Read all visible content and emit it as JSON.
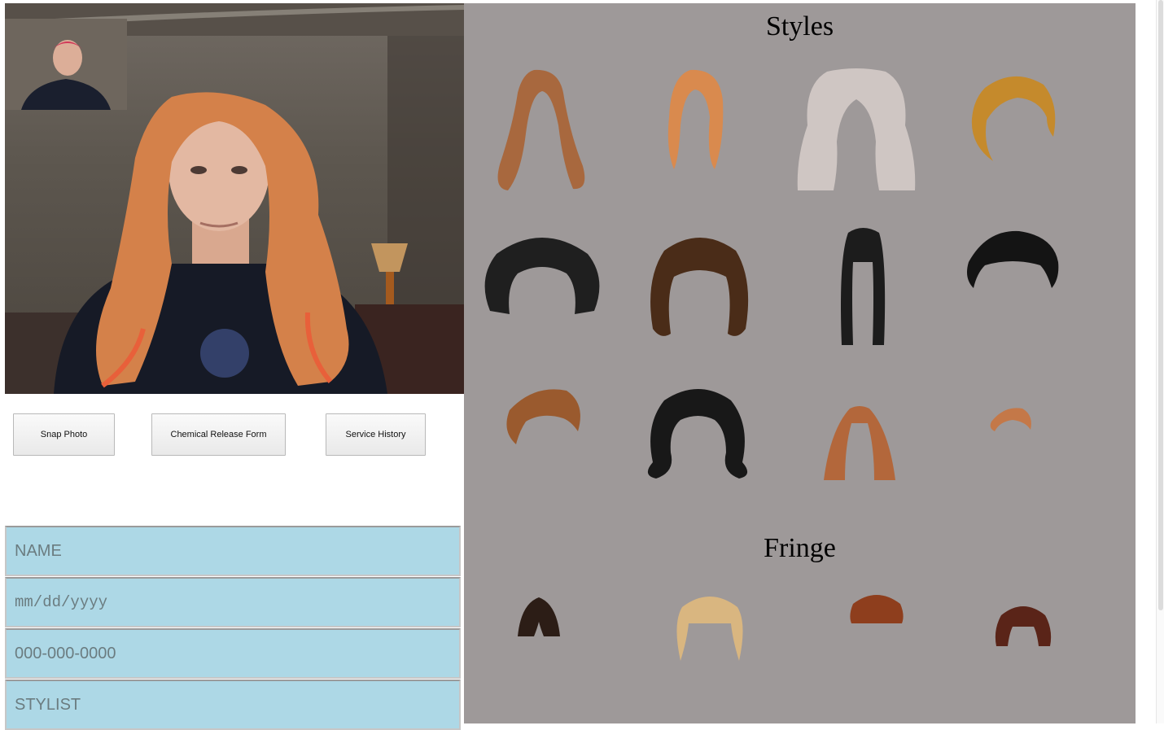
{
  "buttons": {
    "snap": "Snap Photo",
    "chemical": "Chemical Release Form",
    "history": "Service History"
  },
  "form": {
    "name_placeholder": "NAME",
    "date_placeholder": "mm/dd/yyyy",
    "phone_placeholder": "000-000-0000",
    "stylist_placeholder": "STYLIST"
  },
  "panel": {
    "styles_title": "Styles",
    "fringe_title": "Fringe"
  },
  "styles": [
    {
      "name": "long-layered-auburn",
      "color": "#a8683e"
    },
    {
      "name": "side-swept-strawberry-blonde",
      "color": "#d98a4e"
    },
    {
      "name": "long-wavy-platinum",
      "color": "#cfc6c3"
    },
    {
      "name": "short-golden-bob",
      "color": "#c58a2c"
    },
    {
      "name": "curly-afro-black",
      "color": "#1f1f1f"
    },
    {
      "name": "brown-shag",
      "color": "#4a2c18"
    },
    {
      "name": "long-straight-black-bangs",
      "color": "#1c1c1c"
    },
    {
      "name": "short-black-crop",
      "color": "#141414"
    },
    {
      "name": "tousled-copper-pixie",
      "color": "#9a5a2e"
    },
    {
      "name": "black-flipped-bob",
      "color": "#181818"
    },
    {
      "name": "copper-ombre-long",
      "color": "#b3673b"
    },
    {
      "name": "small-ginger-crop",
      "color": "#c47848"
    }
  ],
  "fringes": [
    {
      "name": "dark-brown-fringe",
      "color": "#2c1d16"
    },
    {
      "name": "blonde-fringe",
      "color": "#d9b680"
    },
    {
      "name": "auburn-fringe",
      "color": "#8e3e1d"
    },
    {
      "name": "mahogany-fringe",
      "color": "#5a2418"
    }
  ]
}
